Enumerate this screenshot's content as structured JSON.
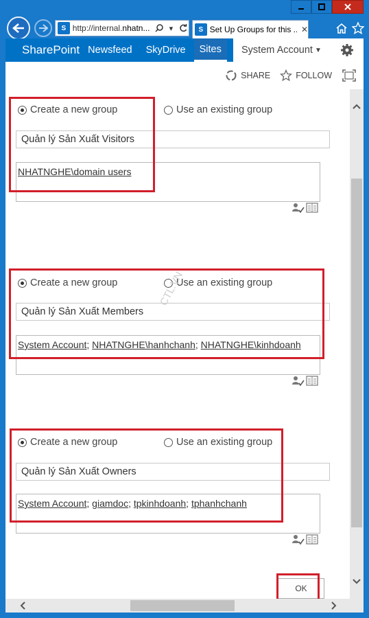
{
  "browser": {
    "url_prefix": "http://internal.",
    "url_host": "nhatn...",
    "tab_title": "Set Up Groups for this ...",
    "sp_icon_text": "S"
  },
  "suitebar": {
    "brand": "SharePoint",
    "links": [
      "Newsfeed",
      "SkyDrive",
      "Sites"
    ],
    "account": "System Account"
  },
  "ribbon": {
    "share": "SHARE",
    "follow": "FOLLOW"
  },
  "groups": [
    {
      "create_label": "Create a new group",
      "existing_label": "Use an existing group",
      "selected": "create",
      "group_name": "Quản lý Sản Xuất Visitors",
      "members": [
        "NHATNGHE\\domain users"
      ],
      "separator": ""
    },
    {
      "create_label": "Create a new group",
      "existing_label": "Use an existing group",
      "selected": "create",
      "group_name": "Quản lý Sản Xuất Members",
      "members": [
        "System Account",
        "NHATNGHE\\hanhchanh",
        "NHATNGHE\\kinhdoanh"
      ],
      "separator": "; "
    },
    {
      "create_label": "Create a new group",
      "existing_label": "Use an existing group",
      "selected": "create",
      "group_name": "Quản lý Sản Xuất Owners",
      "members": [
        "System Account",
        "giamdoc",
        "tpkinhdoanh",
        "tphanhchanh"
      ],
      "separator": "; "
    }
  ],
  "ok_label": "OK",
  "watermark": "CTL.VN",
  "colors": {
    "highlight": "#d11f2a",
    "suitebar": "#0072c6",
    "window": "#1979ca"
  }
}
